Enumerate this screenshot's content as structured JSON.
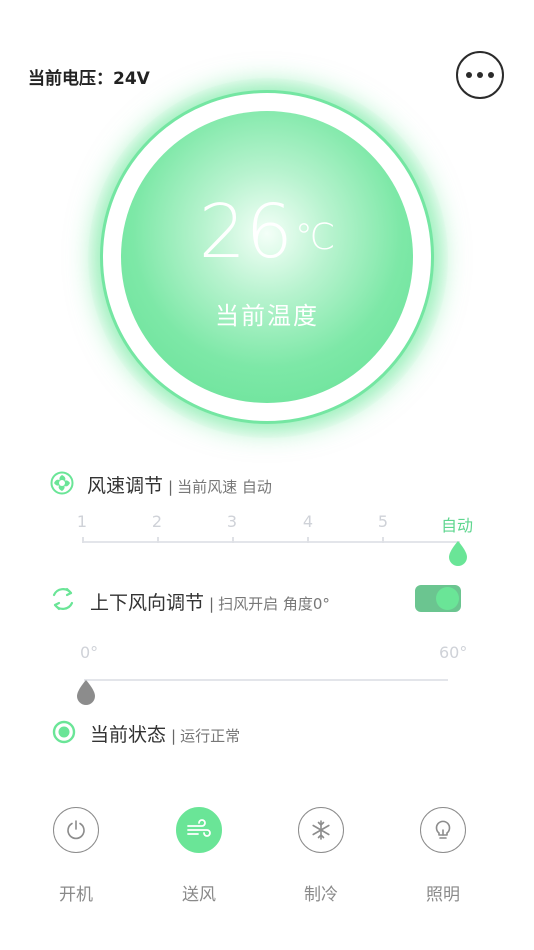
{
  "header": {
    "voltage_text": "当前电压：24V",
    "more_icon": "more-horizontal-icon"
  },
  "dial": {
    "temperature": "26",
    "unit": "℃",
    "label": "当前温度"
  },
  "fan_speed": {
    "icon": "fan-icon",
    "title": "风速调节",
    "separator": "|",
    "subtitle": "当前风速 自动",
    "levels": [
      "1",
      "2",
      "3",
      "4",
      "5",
      "自动"
    ],
    "selected": "自动"
  },
  "swing": {
    "icon": "swing-arrows-icon",
    "title": "上下风向调节",
    "separator": "|",
    "subtitle": "扫风开启  角度0°",
    "toggle_on": true,
    "min_label": "0°",
    "max_label": "60°",
    "angle": 0
  },
  "status": {
    "icon": "status-dot-icon",
    "title": "当前状态",
    "separator": "|",
    "subtitle": "运行正常"
  },
  "bottom_buttons": [
    {
      "icon": "power-icon",
      "label": "开机",
      "active": false
    },
    {
      "icon": "wind-icon",
      "label": "送风",
      "active": true
    },
    {
      "icon": "snowflake-icon",
      "label": "制冷",
      "active": false
    },
    {
      "icon": "lightbulb-icon",
      "label": "照明",
      "active": false
    }
  ],
  "colors": {
    "accent": "#6ae597",
    "accent_dark": "#5fd68f",
    "text": "#333333",
    "muted": "#8a8a8a"
  }
}
